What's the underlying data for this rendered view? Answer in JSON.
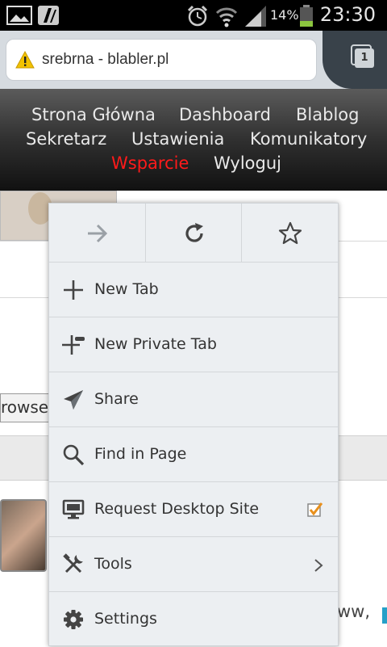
{
  "status_bar": {
    "battery_percent": "14%",
    "time": "23:30",
    "icons": [
      "image-notification-icon",
      "app-notification-icon",
      "alarm-icon",
      "wifi-icon",
      "signal-icon",
      "battery-icon"
    ]
  },
  "url_bar": {
    "url_text": "srebrna - blabler.pl",
    "tabs_count": "1",
    "security_icon": "warning-icon"
  },
  "site_nav": {
    "links": [
      "Strona Główna",
      "Dashboard",
      "Blablog",
      "Sekretarz",
      "Ustawienia",
      "Komunikatory",
      "Wsparcie",
      "Wyloguj"
    ],
    "active_link": "Wsparcie",
    "active_color": "#ff1a1a"
  },
  "page": {
    "browse_text": "rowse.",
    "trailing_text": "ww,"
  },
  "menu": {
    "toolbar": [
      "forward-icon",
      "reload-icon",
      "bookmark-star-icon"
    ],
    "items": [
      {
        "label": "New Tab",
        "icon": "plus-icon"
      },
      {
        "label": "New Private Tab",
        "icon": "private-tab-icon"
      },
      {
        "label": "Share",
        "icon": "share-icon"
      },
      {
        "label": "Find in Page",
        "icon": "search-icon"
      },
      {
        "label": "Request Desktop Site",
        "icon": "desktop-icon",
        "checked": true
      },
      {
        "label": "Tools",
        "icon": "tools-icon",
        "has_submenu": true
      },
      {
        "label": "Settings",
        "icon": "gear-icon"
      }
    ]
  }
}
